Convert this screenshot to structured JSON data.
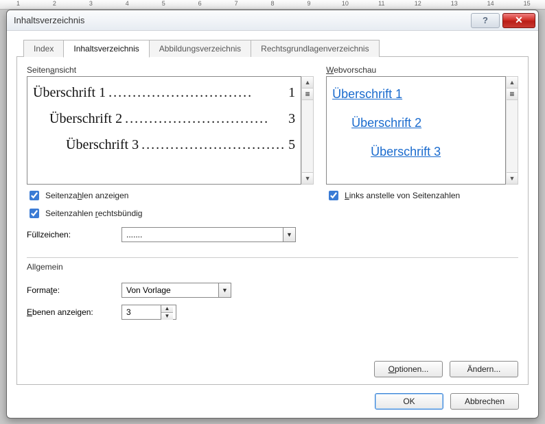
{
  "ruler": [
    "1",
    "2",
    "3",
    "4",
    "5",
    "6",
    "7",
    "8",
    "9",
    "10",
    "11",
    "12",
    "13",
    "14",
    "15"
  ],
  "dialog": {
    "title": "Inhaltsverzeichnis",
    "tabs": {
      "index": "Index",
      "toc": "Inhaltsverzeichnis",
      "figures": "Abbildungsverzeichnis",
      "legal": "Rechtsgrundlagenverzeichnis"
    },
    "print_preview": {
      "label_pre": "Seiten",
      "label_u": "a",
      "label_post": "nsicht",
      "items": [
        {
          "text": "Überschrift 1",
          "page": "1",
          "indent": 0
        },
        {
          "text": "Überschrift 2",
          "page": "3",
          "indent": 1
        },
        {
          "text": "Überschrift 3",
          "page": "5",
          "indent": 2
        }
      ]
    },
    "web_preview": {
      "label_pre": "",
      "label_u": "W",
      "label_post": "ebvorschau",
      "items": [
        {
          "text": "Überschrift 1",
          "indent": 0
        },
        {
          "text": "Überschrift 2",
          "indent": 1
        },
        {
          "text": "Überschrift 3",
          "indent": 2
        }
      ]
    },
    "checks": {
      "show_pagenums_pre": "Seitenza",
      "show_pagenums_u": "h",
      "show_pagenums_post": "len anzeigen",
      "right_align_pre": "Seitenzahlen ",
      "right_align_u": "r",
      "right_align_post": "echtsbündig",
      "links_pre": "",
      "links_u": "L",
      "links_post": "inks anstelle von Seitenzahlen"
    },
    "leader": {
      "label": "Füllzeichen:",
      "value": "......."
    },
    "general": {
      "title": "Allgemein",
      "format_label_pre": "Forma",
      "format_label_u": "t",
      "format_label_post": "e:",
      "format_value": "Von Vorlage",
      "levels_label_pre": "",
      "levels_label_u": "E",
      "levels_label_post": "benen anzeigen:",
      "levels_value": "3"
    },
    "buttons": {
      "options_pre": "",
      "options_u": "O",
      "options_post": "ptionen...",
      "modify": "Ändern...",
      "ok": "OK",
      "cancel": "Abbrechen"
    }
  }
}
